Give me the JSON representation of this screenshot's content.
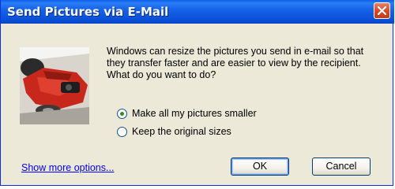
{
  "window": {
    "title": "Send Pictures via E-Mail",
    "close_icon": "close-icon",
    "accent": "#0a5fe6"
  },
  "content": {
    "message": "Windows can resize the pictures you send in e-mail so that they transfer faster and are easier to view by the recipient.  What do you want to do?",
    "image_icon": "picture-thumbnail"
  },
  "options": [
    {
      "label": "Make all my pictures smaller",
      "checked": true
    },
    {
      "label": "Keep the original sizes",
      "checked": false
    }
  ],
  "footer": {
    "more_link": "Show more options...",
    "ok_label": "OK",
    "cancel_label": "Cancel"
  }
}
